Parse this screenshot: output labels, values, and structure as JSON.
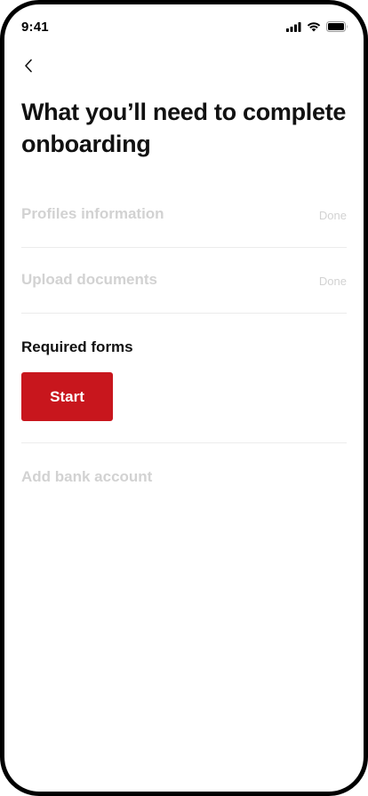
{
  "status_bar": {
    "time": "9:41",
    "icons": [
      "cellular-signal-icon",
      "wifi-icon",
      "battery-icon"
    ]
  },
  "header": {
    "back_icon": "chevron-left-icon",
    "title": "What you’ll need to complete onboarding"
  },
  "steps": [
    {
      "label": "Profiles information",
      "status": "Done"
    },
    {
      "label": "Upload documents",
      "status": "Done"
    }
  ],
  "active_step": {
    "label": "Required forms",
    "button_label": "Start"
  },
  "last_step": {
    "label": "Add bank account"
  },
  "colors": {
    "accent": "#c8161d",
    "text": "#111111",
    "muted": "#d2d2d2",
    "divider": "#ececec"
  }
}
